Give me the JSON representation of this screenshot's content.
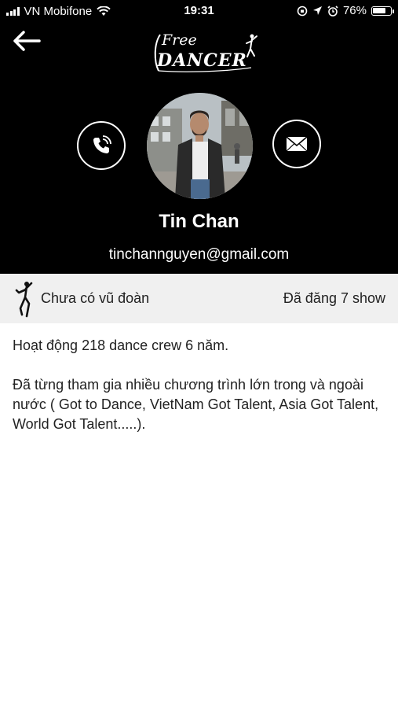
{
  "status_bar": {
    "carrier": "VN Mobifone",
    "time": "19:31",
    "battery": "76%",
    "battery_level": 0.76
  },
  "header": {
    "logo_free": "Free",
    "logo_dancer": "DANCER"
  },
  "profile": {
    "name": "Tin Chan",
    "email": "tinchannguyen@gmail.com"
  },
  "info_bar": {
    "crew_status": "Chưa có vũ đoàn",
    "shows": "Đã đăng 7 show"
  },
  "bio": {
    "paragraph_1": "Hoạt động 218 dance crew 6 năm.",
    "paragraph_2": "Đã từng tham gia nhiều chương trình lớn trong và ngoài nước ( Got to Dance, VietNam Got Talent, Asia Got Talent, World Got Talent.....)."
  },
  "colors": {
    "header_bg": "#000000",
    "info_bar_bg": "#f0f0f0",
    "text": "#222222"
  },
  "icons": [
    "back-arrow-icon",
    "phone-icon",
    "mail-icon",
    "dancer-icon",
    "wifi-icon",
    "location-icon",
    "alarm-icon"
  ]
}
